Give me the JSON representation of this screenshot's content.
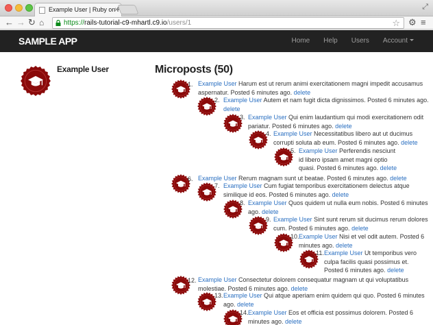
{
  "browser": {
    "tab_title": "Example User | Ruby on Ra",
    "url_scheme": "https://",
    "url_host": "rails-tutorial-c9-mhartl.c9.io",
    "url_path": "/users/1"
  },
  "navbar": {
    "logo": "SAMPLE APP",
    "links": [
      "Home",
      "Help",
      "Users",
      "Account"
    ]
  },
  "user": {
    "name": "Example User"
  },
  "microposts_heading": "Microposts (50)",
  "posts": [
    {
      "num": "1.",
      "user": "Example User",
      "text": "Harum est ut rerum animi exercitationem magni impedit accusamus aspernatur. Posted 6 minutes ago.",
      "delete": "delete"
    },
    {
      "num": "2.",
      "user": "Example User",
      "text": "Autem et nam fugit dicta dignissimos. Posted 6 minutes ago.",
      "delete": "delete"
    },
    {
      "num": "3.",
      "user": "Example User",
      "text": "Qui enim laudantium qui modi exercitationem odit pariatur. Posted 6 minutes ago.",
      "delete": "delete"
    },
    {
      "num": "4.",
      "user": "Example User",
      "text": "Necessitatibus libero aut ut ducimus corrupti soluta ab eum. Posted 6 minutes ago.",
      "delete": "delete"
    },
    {
      "num": "5.",
      "user": "Example User",
      "text": "Perferendis nesciunt id libero ipsam amet magni optio quasi. Posted 6 minutes ago.",
      "delete": "delete"
    },
    {
      "num": "6.",
      "user": "Example User",
      "text": "Rerum magnam sunt ut beatae. Posted 6 minutes ago.",
      "delete": "delete"
    },
    {
      "num": "7.",
      "user": "Example User",
      "text": "Cum fugiat temporibus exercitationem delectus atque similique id eos. Posted 6 minutes ago.",
      "delete": "delete"
    },
    {
      "num": "8.",
      "user": "Example User",
      "text": "Quos quidem ut nulla eum nobis. Posted 6 minutes ago.",
      "delete": "delete"
    },
    {
      "num": "9.",
      "user": "Example User",
      "text": "Sint sunt rerum sit ducimus rerum dolores cum. Posted 6 minutes ago.",
      "delete": "delete"
    },
    {
      "num": "10.",
      "user": "Example User",
      "text": "Nisi et vel odit autem. Posted 6 minutes ago.",
      "delete": "delete"
    },
    {
      "num": "11.",
      "user": "Example User",
      "text": "Ut temporibus vero culpa facilis quasi possimus et. Posted 6 minutes ago.",
      "delete": "delete"
    },
    {
      "num": "12.",
      "user": "Example User",
      "text": "Consectetur dolorem consequatur magnam ut qui voluptatibus molestiae. Posted 6 minutes ago.",
      "delete": "delete"
    },
    {
      "num": "13.",
      "user": "Example User",
      "text": "Qui atque aperiam enim quidem qui quo. Posted 6 minutes ago.",
      "delete": "delete"
    },
    {
      "num": "14.",
      "user": "Example User",
      "text": "Eos et officia est possimus dolorem. Posted 6 minutes ago.",
      "delete": "delete"
    }
  ]
}
